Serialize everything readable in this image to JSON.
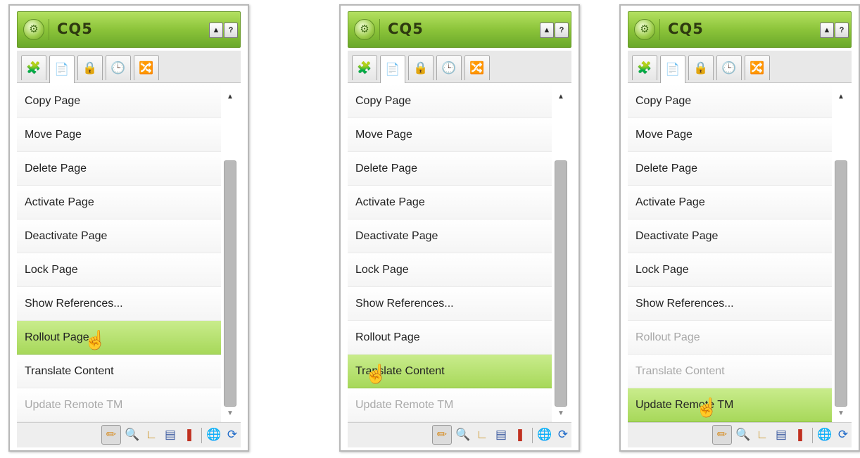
{
  "panels": [
    {
      "title": "CQ5",
      "buttons": {
        "collapse": "▲",
        "help": "?"
      },
      "tabs": [
        "components-icon",
        "page-icon",
        "lock-icon",
        "clock-icon",
        "workflow-icon"
      ],
      "items": [
        {
          "label": "Copy Page",
          "state": "normal"
        },
        {
          "label": "Move Page",
          "state": "normal"
        },
        {
          "label": "Delete Page",
          "state": "normal"
        },
        {
          "label": "Activate Page",
          "state": "normal"
        },
        {
          "label": "Deactivate Page",
          "state": "normal"
        },
        {
          "label": "Lock Page",
          "state": "normal"
        },
        {
          "label": "Show References...",
          "state": "normal"
        },
        {
          "label": "Rollout Page",
          "state": "highlighted"
        },
        {
          "label": "Translate Content",
          "state": "normal"
        },
        {
          "label": "Update Remote TM",
          "state": "disabled"
        }
      ]
    },
    {
      "title": "CQ5",
      "buttons": {
        "collapse": "▲",
        "help": "?"
      },
      "tabs": [
        "components-icon",
        "page-icon",
        "lock-icon",
        "clock-icon",
        "workflow-icon"
      ],
      "items": [
        {
          "label": "Copy Page",
          "state": "normal"
        },
        {
          "label": "Move Page",
          "state": "normal"
        },
        {
          "label": "Delete Page",
          "state": "normal"
        },
        {
          "label": "Activate Page",
          "state": "normal"
        },
        {
          "label": "Deactivate Page",
          "state": "normal"
        },
        {
          "label": "Lock Page",
          "state": "normal"
        },
        {
          "label": "Show References...",
          "state": "normal"
        },
        {
          "label": "Rollout Page",
          "state": "normal"
        },
        {
          "label": "Translate Content",
          "state": "highlighted"
        },
        {
          "label": "Update Remote TM",
          "state": "disabled"
        }
      ]
    },
    {
      "title": "CQ5",
      "buttons": {
        "collapse": "▲",
        "help": "?"
      },
      "tabs": [
        "components-icon",
        "page-icon",
        "lock-icon",
        "clock-icon",
        "workflow-icon"
      ],
      "items": [
        {
          "label": "Copy Page",
          "state": "normal"
        },
        {
          "label": "Move Page",
          "state": "normal"
        },
        {
          "label": "Delete Page",
          "state": "normal"
        },
        {
          "label": "Activate Page",
          "state": "normal"
        },
        {
          "label": "Deactivate Page",
          "state": "normal"
        },
        {
          "label": "Lock Page",
          "state": "normal"
        },
        {
          "label": "Show References...",
          "state": "normal"
        },
        {
          "label": "Rollout Page",
          "state": "disabled"
        },
        {
          "label": "Translate Content",
          "state": "disabled"
        },
        {
          "label": "Update Remote TM",
          "state": "highlighted"
        }
      ]
    }
  ],
  "toolbar_icons": [
    "edit-pencil-icon",
    "search-icon",
    "ruler-icon",
    "document-icon",
    "debug-icon",
    "globe-icon",
    "refresh-icon"
  ],
  "colors": {
    "accent_green": "#a7d85a",
    "title_green": "#8cc43a",
    "disabled_text": "#a8a8a8"
  }
}
